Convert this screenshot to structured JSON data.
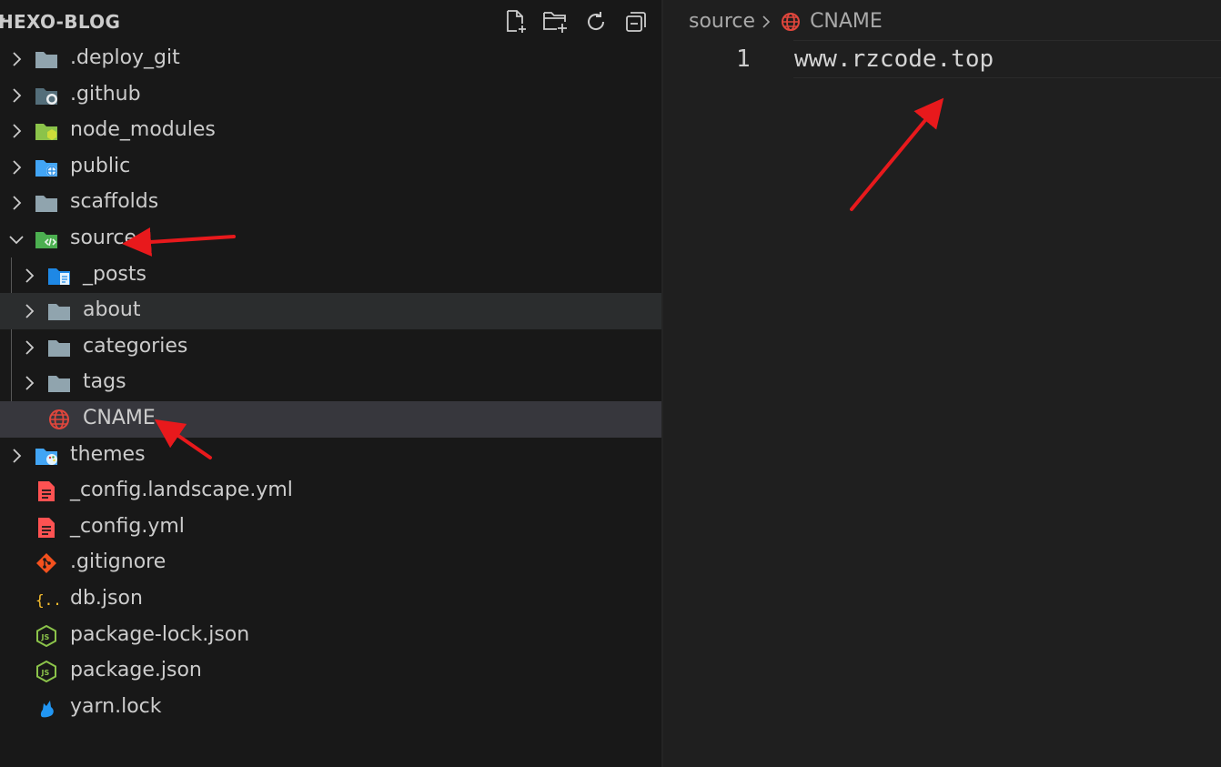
{
  "explorer": {
    "title": "HEXO-BLOG",
    "actions": [
      {
        "icon": "new-file-icon"
      },
      {
        "icon": "new-folder-icon"
      },
      {
        "icon": "refresh-icon"
      },
      {
        "icon": "collapse-all-icon"
      }
    ],
    "items": [
      {
        "label": ".deploy_git",
        "type": "folder",
        "icon": "folder-icon",
        "expanded": false,
        "depth": 0
      },
      {
        "label": ".github",
        "type": "folder",
        "icon": "folder-github-icon",
        "expanded": false,
        "depth": 0
      },
      {
        "label": "node_modules",
        "type": "folder",
        "icon": "folder-node-icon",
        "expanded": false,
        "depth": 0
      },
      {
        "label": "public",
        "type": "folder",
        "icon": "folder-public-icon",
        "expanded": false,
        "depth": 0
      },
      {
        "label": "scaffolds",
        "type": "folder",
        "icon": "folder-icon",
        "expanded": false,
        "depth": 0
      },
      {
        "label": "source",
        "type": "folder",
        "icon": "folder-source-icon",
        "expanded": true,
        "depth": 0
      },
      {
        "label": "_posts",
        "type": "folder",
        "icon": "folder-posts-icon",
        "expanded": false,
        "depth": 1
      },
      {
        "label": "about",
        "type": "folder",
        "icon": "folder-icon",
        "expanded": false,
        "depth": 1,
        "state": "hover"
      },
      {
        "label": "categories",
        "type": "folder",
        "icon": "folder-icon",
        "expanded": false,
        "depth": 1
      },
      {
        "label": "tags",
        "type": "folder",
        "icon": "folder-icon",
        "expanded": false,
        "depth": 1
      },
      {
        "label": "CNAME",
        "type": "file",
        "icon": "globe-icon",
        "depth": 1,
        "state": "selected"
      },
      {
        "label": "themes",
        "type": "folder",
        "icon": "folder-themes-icon",
        "expanded": false,
        "depth": 0
      },
      {
        "label": "_config.landscape.yml",
        "type": "file",
        "icon": "yaml-file-icon",
        "depth": 0
      },
      {
        "label": "_config.yml",
        "type": "file",
        "icon": "yaml-file-icon",
        "depth": 0
      },
      {
        "label": ".gitignore",
        "type": "file",
        "icon": "git-icon",
        "depth": 0
      },
      {
        "label": "db.json",
        "type": "file",
        "icon": "json-icon",
        "depth": 0
      },
      {
        "label": "package-lock.json",
        "type": "file",
        "icon": "nodejs-icon",
        "depth": 0
      },
      {
        "label": "package.json",
        "type": "file",
        "icon": "nodejs-icon",
        "depth": 0
      },
      {
        "label": "yarn.lock",
        "type": "file",
        "icon": "yarn-icon",
        "depth": 0
      }
    ]
  },
  "editor": {
    "breadcrumb": [
      "source",
      "CNAME"
    ],
    "lines": [
      {
        "number": "1",
        "text": "www.rzcode.top"
      }
    ]
  },
  "colors": {
    "background": "#181818",
    "editor_background": "#1f1f1f",
    "selected_row": "#37373d",
    "hover_row": "#2b2d2e",
    "annotation_arrow": "#e8191c"
  }
}
